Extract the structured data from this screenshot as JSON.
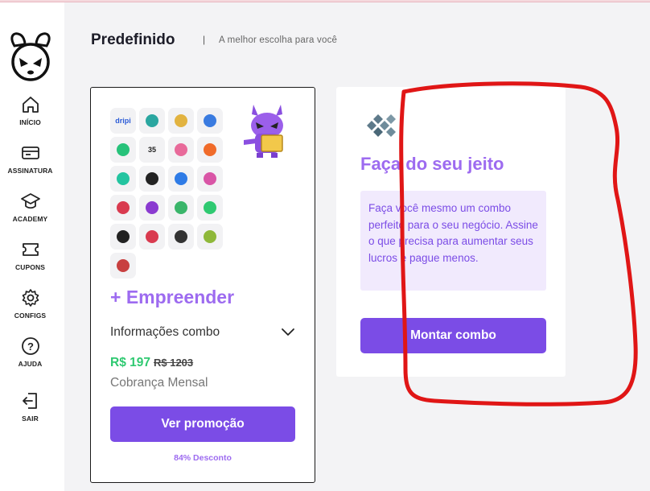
{
  "sidebar": {
    "items": [
      {
        "label": "INÍCIO",
        "icon": "home-icon"
      },
      {
        "label": "ASSINATURA",
        "icon": "card-icon"
      },
      {
        "label": "ACADEMY",
        "icon": "graduation-cap-icon"
      },
      {
        "label": "CUPONS",
        "icon": "ticket-icon"
      },
      {
        "label": "CONFIGS",
        "icon": "gear-icon"
      },
      {
        "label": "AJUDA",
        "icon": "help-icon"
      },
      {
        "label": "SAIR",
        "icon": "logout-icon"
      }
    ]
  },
  "header": {
    "title": "Predefinido",
    "separator": "|",
    "subtitle": "A melhor escolha para você"
  },
  "combo_card": {
    "title": "+ Empreender",
    "info_label": "Informações combo",
    "price": "R$ 197",
    "old_price": "R$ 1203",
    "billing": "Cobrança Mensal",
    "button_label": "Ver promoção",
    "discount": "84% Desconto",
    "app_icons": [
      {
        "text": "dripi",
        "color": "#2b5bd7"
      },
      {
        "text": "",
        "color": "#2aa6a0"
      },
      {
        "text": "",
        "color": "#e2b340"
      },
      {
        "text": "",
        "color": "#3a7be0"
      },
      {
        "text": "",
        "color": "#27c27a"
      },
      {
        "text": "35",
        "color": "#222222"
      },
      {
        "text": "",
        "color": "#e86a9a"
      },
      {
        "text": "",
        "color": "#f06b2a"
      },
      {
        "text": "",
        "color": "#23c4a0"
      },
      {
        "text": "",
        "color": "#222222"
      },
      {
        "text": "",
        "color": "#2e7be6"
      },
      {
        "text": "",
        "color": "#d955a6"
      },
      {
        "text": "",
        "color": "#d93a4f"
      },
      {
        "text": "",
        "color": "#8a3ad0"
      },
      {
        "text": "",
        "color": "#3ab56a"
      },
      {
        "text": "",
        "color": "#2fc971"
      },
      {
        "text": "",
        "color": "#222222"
      },
      {
        "text": "",
        "color": "#d93a4f"
      },
      {
        "text": "",
        "color": "#333333"
      },
      {
        "text": "",
        "color": "#8fb83a"
      },
      {
        "text": "",
        "color": "#c84040"
      }
    ]
  },
  "custom_card": {
    "title": "Faça do seu jeito",
    "description": "Faça você mesmo um combo perfeito para o seu negócio. Assine o que precisa para aumentar seus lucros e pague menos.",
    "button_label": "Montar combo"
  },
  "colors": {
    "accent": "#7b4ce6",
    "accent_light": "#9d6bf0",
    "price_green": "#2fc971",
    "annotation_red": "#e01616"
  }
}
